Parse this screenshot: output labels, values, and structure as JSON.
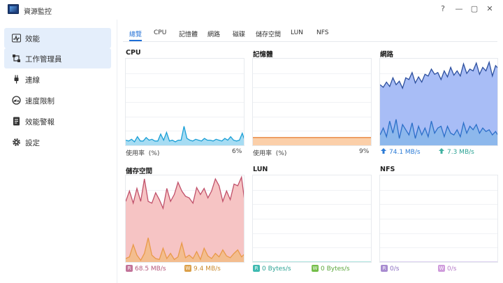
{
  "window": {
    "title": "資源監控"
  },
  "window_controls": {
    "help": "?",
    "minimize": "—",
    "maximize": "▢",
    "close": "✕"
  },
  "sidebar": {
    "items": [
      {
        "label": "效能",
        "icon": "performance-icon"
      },
      {
        "label": "工作管理員",
        "icon": "task-manager-icon"
      },
      {
        "label": "連線",
        "icon": "plug-icon"
      },
      {
        "label": "速度限制",
        "icon": "speed-limit-icon"
      },
      {
        "label": "效能警報",
        "icon": "alert-doc-icon"
      },
      {
        "label": "設定",
        "icon": "gear-icon"
      }
    ]
  },
  "tabs": [
    "總覽",
    "CPU",
    "記憶體",
    "網路",
    "磁碟",
    "儲存空間",
    "LUN",
    "NFS"
  ],
  "panels": {
    "cpu": {
      "title": "CPU",
      "usage_label": "使用率",
      "unit": "(%)",
      "value": "6%"
    },
    "memory": {
      "title": "記憶體",
      "usage_label": "使用率",
      "unit": "(%)",
      "value": "9%"
    },
    "network": {
      "title": "網路",
      "up": "74.1 MB/s",
      "down": "7.3 MB/s"
    },
    "storage": {
      "title": "儲存空間",
      "read_badge": "R",
      "read": "68.5 MB/s",
      "write_badge": "W",
      "write": "9.4 MB/s"
    },
    "lun": {
      "title": "LUN",
      "read_badge": "R",
      "read": "0 Bytes/s",
      "write_badge": "W",
      "write": "0 Bytes/s"
    },
    "nfs": {
      "title": "NFS",
      "read_badge": "R",
      "read": "0/s",
      "write_badge": "W",
      "write": "0/s"
    }
  },
  "colors": {
    "accent": "#1f6fd6",
    "cpu_line": "#1a9fd6",
    "cpu_fill": "#a6dcf3",
    "memory_line": "#e8853d",
    "memory_fill": "#fbcfa9",
    "network_line": "#2c4f9e",
    "network_fill": "#a8bdf6",
    "network_line2": "#2c6fc9",
    "network_fill2": "#8db8ec",
    "storage_line": "#c0506a",
    "storage_fill": "#f6c4c4",
    "storage_line2": "#e99a4a",
    "storage_fill2": "#f3bd8f",
    "read_badge": "#c2749a",
    "write_badge": "#dba04a",
    "lun_badge": "#3fbab1",
    "lun_write_badge": "#74be4a",
    "nfs_badge": "#a88bd0",
    "nfs_write_badge": "#cf9bdc",
    "up_arrow": "#2c7bd6",
    "down_arrow": "#3fb0a0"
  },
  "chart_data": [
    {
      "type": "area",
      "title": "CPU",
      "ylim": [
        0,
        100
      ],
      "values": [
        6,
        5,
        7,
        4,
        10,
        5,
        5,
        9,
        6,
        7,
        5,
        5,
        13,
        6,
        15,
        5,
        6,
        4,
        6,
        6,
        22,
        8,
        6,
        5,
        7,
        6,
        5,
        8,
        6,
        6,
        5,
        7,
        6,
        5,
        8,
        6,
        10,
        6,
        5,
        6,
        14,
        4
      ]
    },
    {
      "type": "area",
      "title": "記憶體",
      "ylim": [
        0,
        100
      ],
      "values": [
        9,
        9,
        9,
        9,
        9,
        9,
        9,
        9,
        9,
        9,
        9,
        9,
        9,
        9,
        9,
        9,
        9,
        9,
        9,
        9
      ]
    },
    {
      "type": "area",
      "title": "網路",
      "series": [
        {
          "values": [
            70,
            67,
            73,
            68,
            78,
            70,
            74,
            66,
            78,
            76,
            84,
            72,
            79,
            73,
            82,
            80,
            88,
            82,
            84,
            76,
            86,
            79,
            90,
            81,
            86,
            80,
            94,
            83,
            88,
            86,
            95,
            82,
            90,
            86,
            96,
            80,
            92,
            88
          ]
        },
        {
          "values": [
            12,
            20,
            10,
            28,
            14,
            30,
            8,
            24,
            18,
            12,
            26,
            8,
            22,
            12,
            20,
            10,
            28,
            14,
            20,
            22,
            10,
            22,
            14,
            12,
            18,
            10,
            26,
            14,
            22,
            18,
            24,
            14,
            20,
            16,
            18,
            12,
            16,
            10
          ]
        }
      ]
    },
    {
      "type": "area",
      "title": "儲存空間",
      "series": [
        {
          "values": [
            70,
            82,
            68,
            85,
            70,
            96,
            70,
            68,
            80,
            72,
            62,
            85,
            70,
            78,
            92,
            82,
            76,
            74,
            68,
            86,
            78,
            85,
            74,
            82,
            96,
            88,
            70,
            82,
            72,
            90,
            88,
            98,
            65
          ]
        },
        {
          "values": [
            4,
            6,
            20,
            8,
            2,
            10,
            28,
            8,
            4,
            3,
            16,
            4,
            10,
            3,
            6,
            22,
            5,
            8,
            4,
            12,
            3,
            16,
            7,
            4,
            10,
            6,
            14,
            7,
            5,
            10,
            14,
            6,
            10
          ]
        }
      ]
    },
    {
      "type": "area",
      "title": "LUN",
      "values": [
        0,
        0,
        0,
        0,
        0
      ]
    },
    {
      "type": "area",
      "title": "NFS",
      "values": [
        0,
        0,
        0,
        0,
        0
      ]
    }
  ]
}
